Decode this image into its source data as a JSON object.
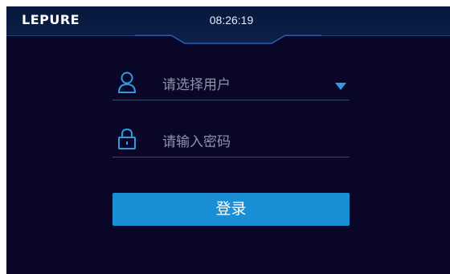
{
  "header": {
    "logo": "LEPURE",
    "time": "08:26:19"
  },
  "login_form": {
    "user_select": {
      "placeholder": "请选择用户",
      "icon": "user-icon"
    },
    "password_field": {
      "placeholder": "请输入密码",
      "icon": "lock-icon"
    },
    "login_button_label": "登录"
  },
  "colors": {
    "background": "#0a0628",
    "header": "#0b1f47",
    "accent": "#1a8fd5",
    "placeholder_text": "#8e93a8"
  }
}
